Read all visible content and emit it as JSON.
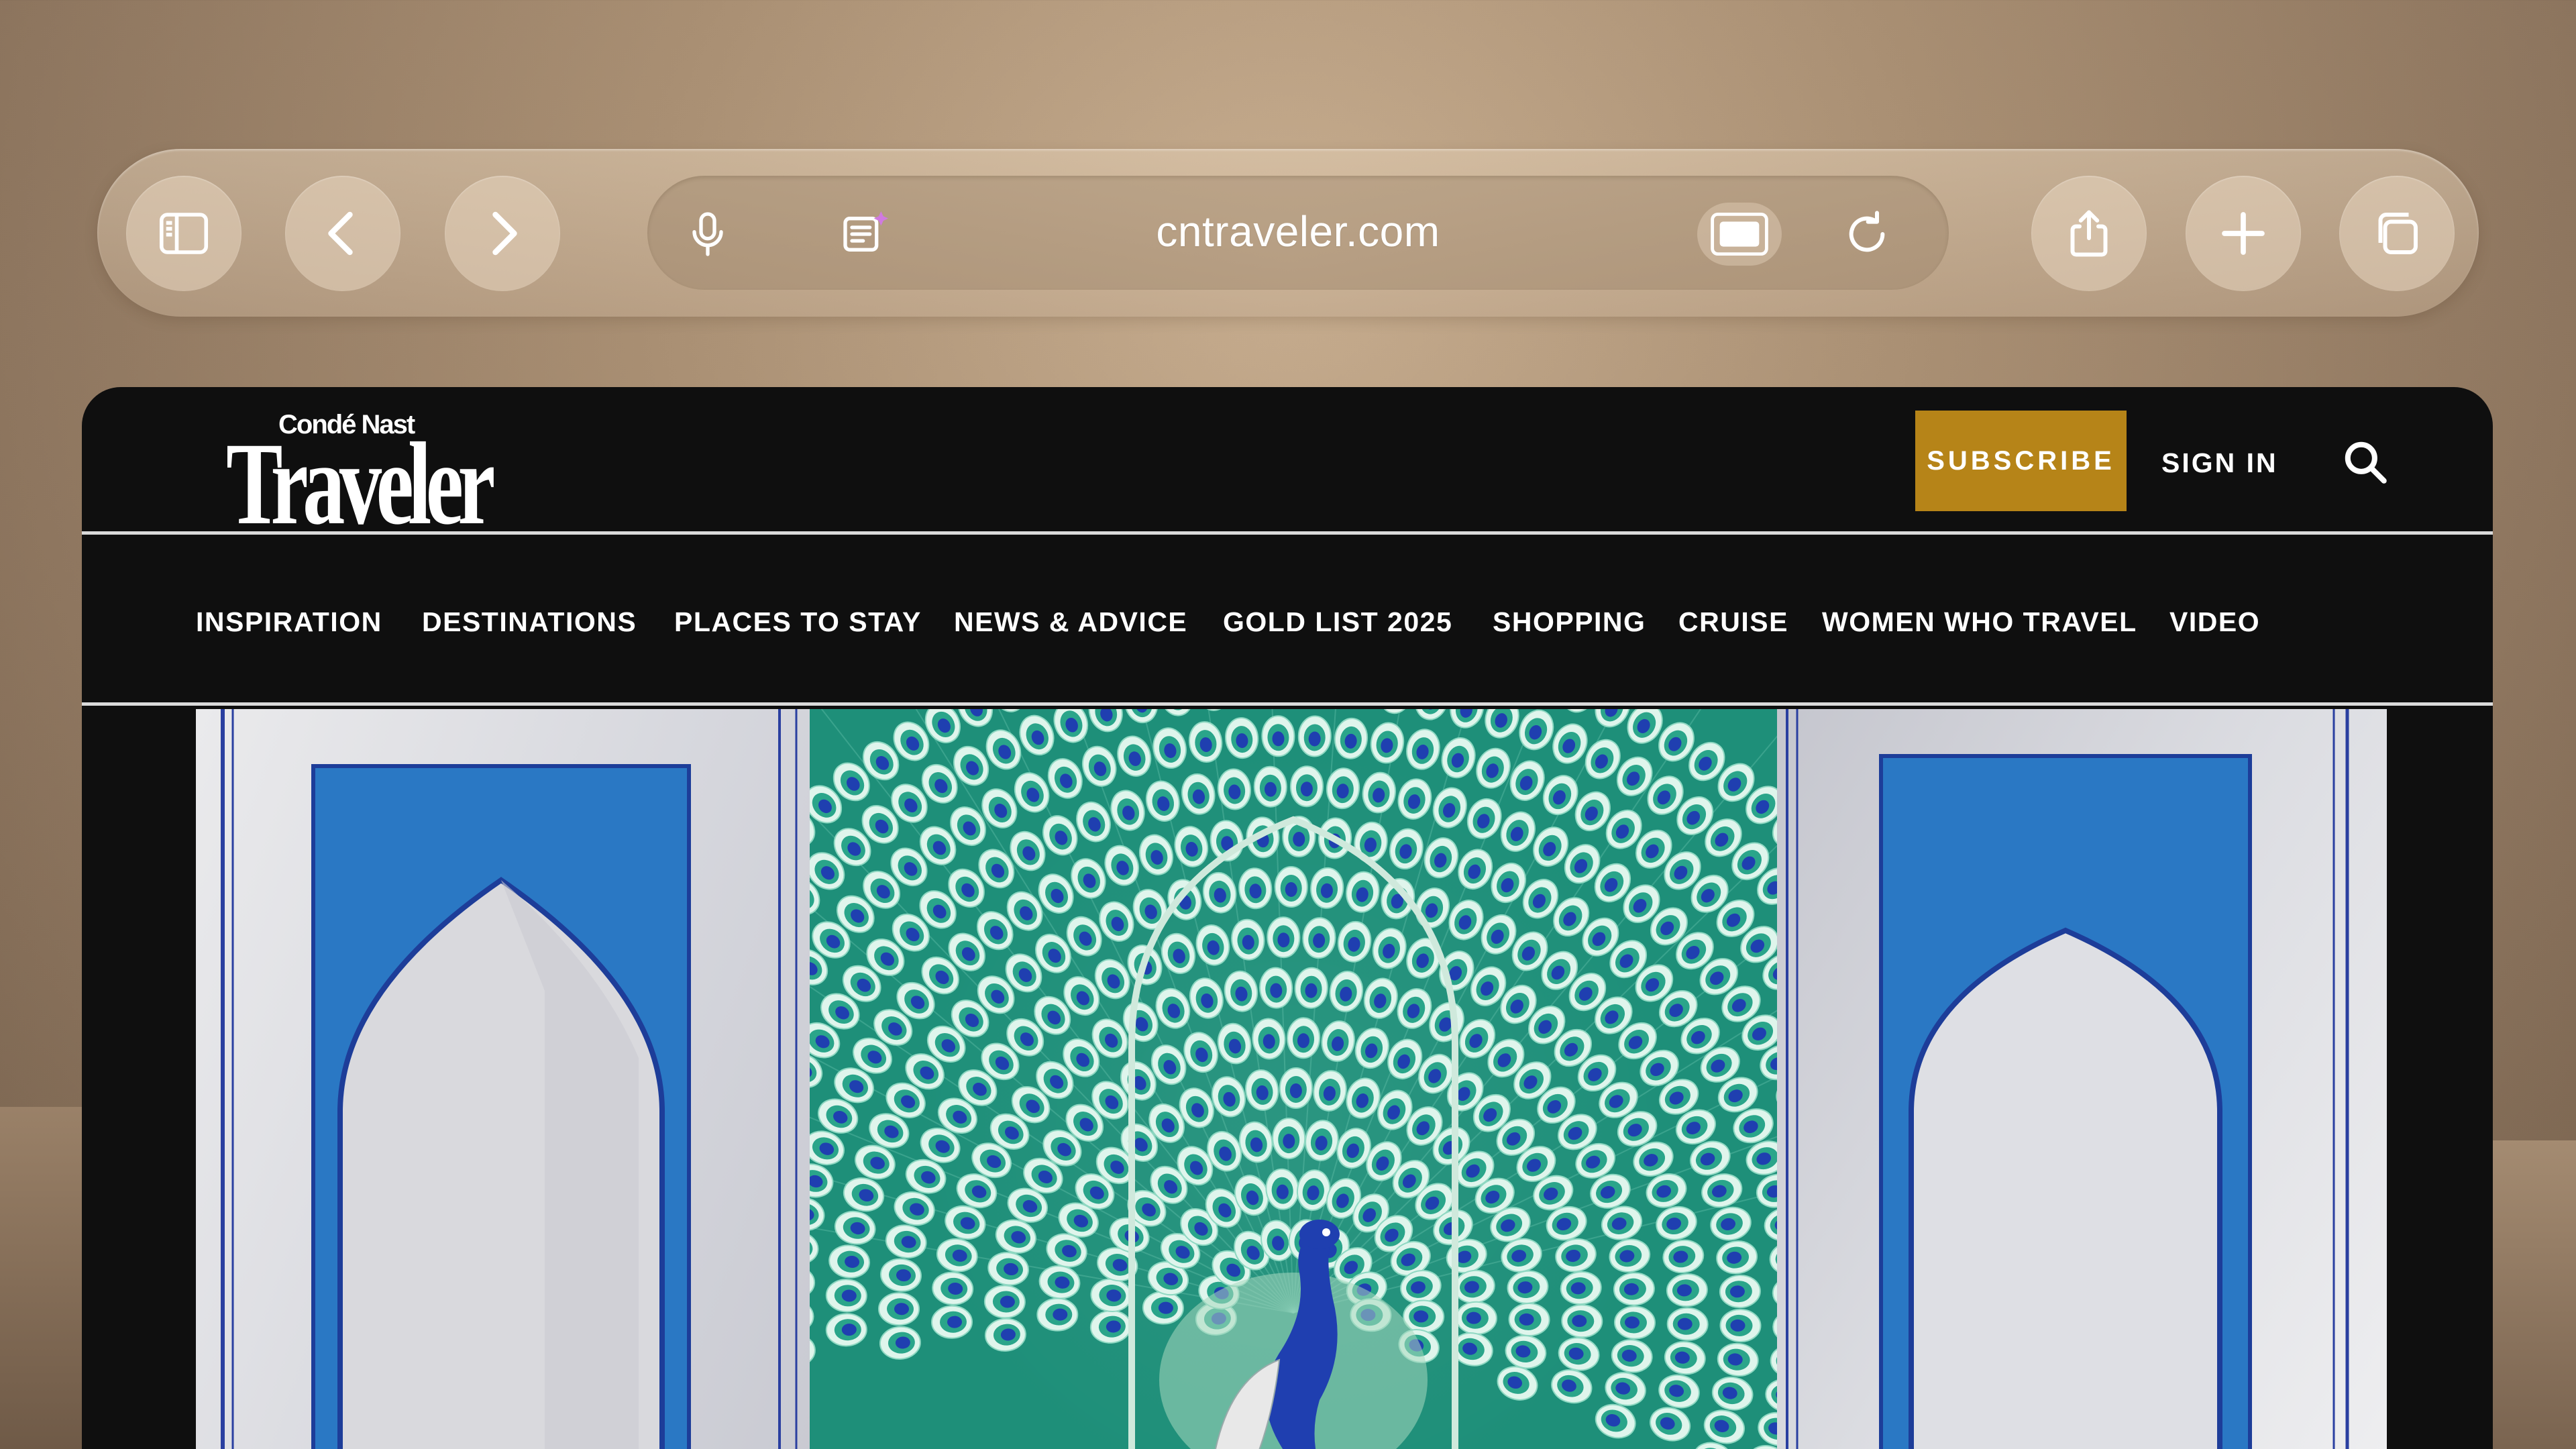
{
  "toolbar": {
    "url": "cntraveler.com",
    "buttons": {
      "sidebar": "sidebar-icon",
      "back": "chevron-left-icon",
      "forward": "chevron-right-icon",
      "microphone": "microphone-icon",
      "reader": "reader-summary-icon",
      "view_mode": "viewing-mode-icon",
      "reload": "reload-icon",
      "share": "share-icon",
      "new_tab": "plus-icon",
      "tabs": "tabs-icon"
    }
  },
  "site": {
    "logo_small": "Condé Nast",
    "logo_big": "Traveler",
    "subscribe": "SUBSCRIBE",
    "sign_in": "SIGN IN",
    "nav": [
      "INSPIRATION",
      "DESTINATIONS",
      "PLACES TO STAY",
      "NEWS & ADVICE",
      "GOLD LIST 2025",
      "SHOPPING",
      "CRUISE",
      "WOMEN WHO TRAVEL",
      "VIDEO"
    ]
  },
  "colors": {
    "subscribe_bg": "#b68418",
    "site_bg": "#0f0f0f",
    "peacock_teal": "#1e8f79",
    "arch_blue": "#1f6fc0"
  }
}
